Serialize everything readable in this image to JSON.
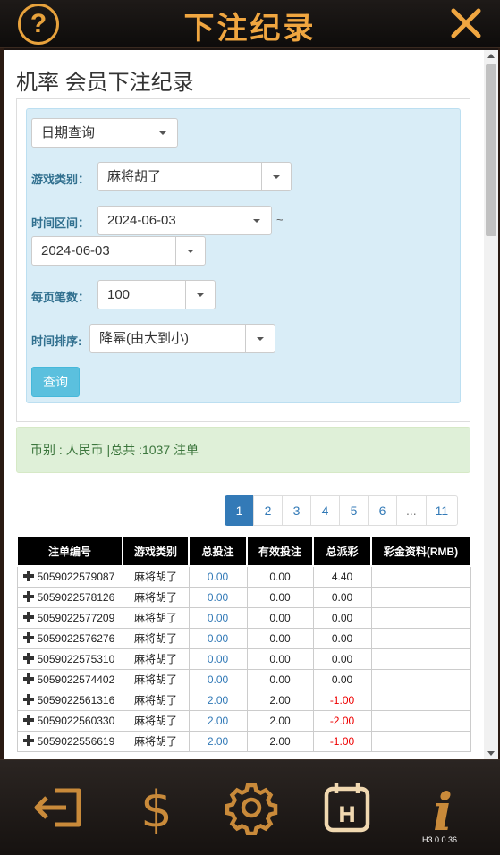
{
  "header": {
    "title": "下注纪录",
    "help_icon": "question-circle-icon",
    "close_icon": "close-icon"
  },
  "page": {
    "title": "机率 会员下注纪录"
  },
  "form": {
    "query_type": "日期查询",
    "game_type_label": "游戏类别：",
    "game_type_value": "麻将胡了",
    "time_range_label": "时间区间：",
    "date_from": "2024-06-03",
    "range_sep": "~",
    "date_to": "2024-06-03",
    "per_page_label": "每页笔数：",
    "per_page_value": "100",
    "sort_label": "时间排序:",
    "sort_value": "降幂(由大到小)",
    "query_button": "查询"
  },
  "summary": {
    "text": "币别 : 人民币 |总共 :1037 注单"
  },
  "pagination": [
    "1",
    "2",
    "3",
    "4",
    "5",
    "6",
    "...",
    "11"
  ],
  "table": {
    "headers": [
      "注单编号",
      "游戏类别",
      "总投注",
      "有效投注",
      "总派彩",
      "彩金资料(RMB)"
    ],
    "rows": [
      [
        "5059022579087",
        "麻将胡了",
        "0.00",
        "0.00",
        "4.40",
        ""
      ],
      [
        "5059022578126",
        "麻将胡了",
        "0.00",
        "0.00",
        "0.00",
        ""
      ],
      [
        "5059022577209",
        "麻将胡了",
        "0.00",
        "0.00",
        "0.00",
        ""
      ],
      [
        "5059022576276",
        "麻将胡了",
        "0.00",
        "0.00",
        "0.00",
        ""
      ],
      [
        "5059022575310",
        "麻将胡了",
        "0.00",
        "0.00",
        "0.00",
        ""
      ],
      [
        "5059022574402",
        "麻将胡了",
        "0.00",
        "0.00",
        "0.00",
        ""
      ],
      [
        "5059022561316",
        "麻将胡了",
        "2.00",
        "2.00",
        "-1.00",
        ""
      ],
      [
        "5059022560330",
        "麻将胡了",
        "2.00",
        "2.00",
        "-2.00",
        ""
      ],
      [
        "5059022556619",
        "麻将胡了",
        "2.00",
        "2.00",
        "-1.00",
        ""
      ]
    ]
  },
  "footer": {
    "icons": [
      "logout-icon",
      "dollar-icon",
      "gear-icon",
      "history-icon",
      "info-icon"
    ],
    "version": "H3 0.0.36"
  },
  "colors": {
    "accent": "#f0a640",
    "primary": "#337ab7",
    "negative": "#e00000"
  }
}
